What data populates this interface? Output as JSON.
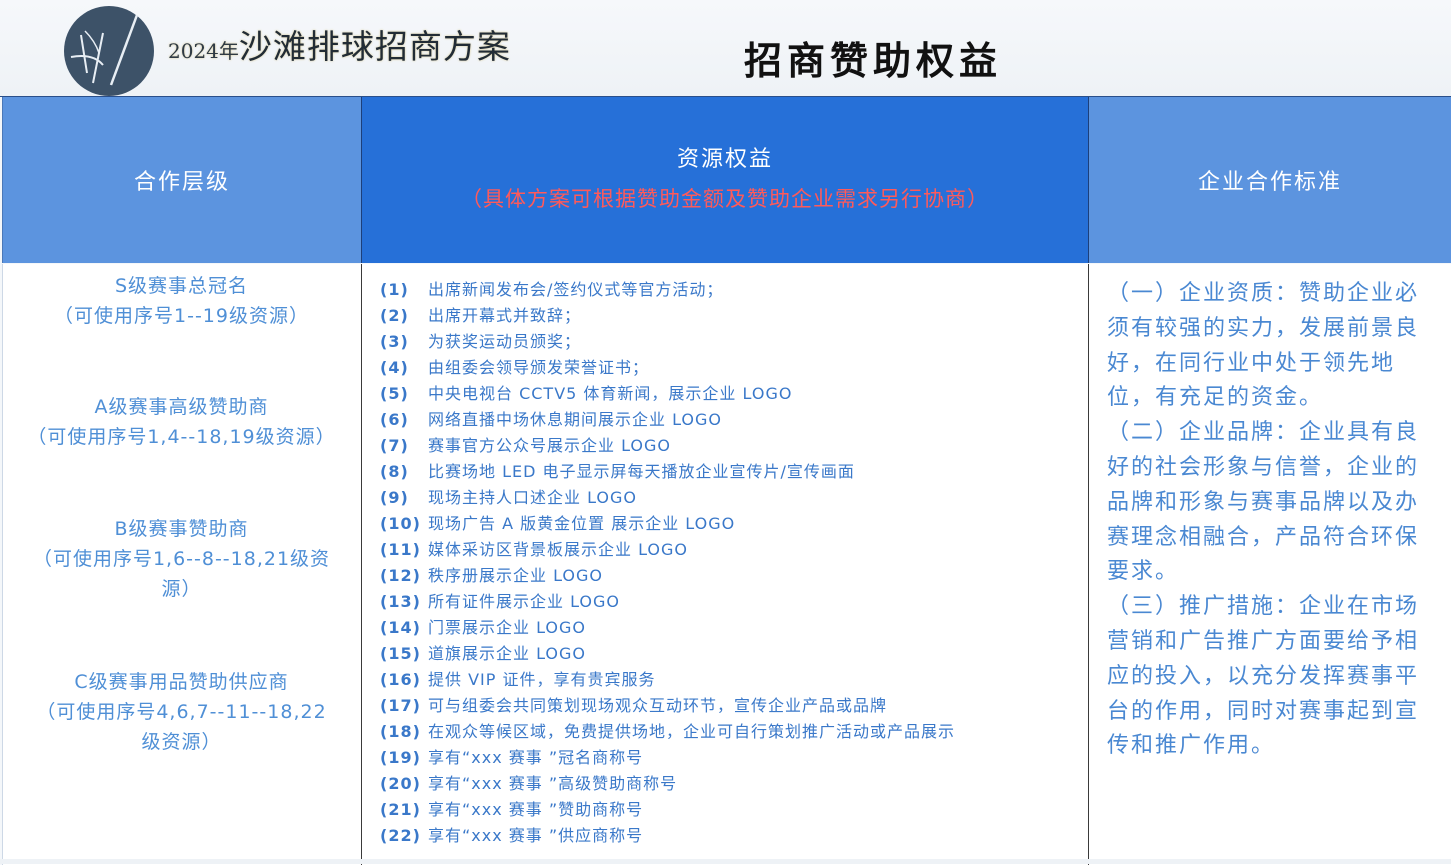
{
  "header": {
    "year": "2024年",
    "project_name": "沙滩排球招商方案",
    "page_title": "招商赞助权益"
  },
  "table": {
    "col_level_header": "合作层级",
    "col_resources_header": "资源权益",
    "col_resources_note": "（具体方案可根据赞助金额及赞助企业需求另行协商）",
    "col_standard_header": "企业合作标准"
  },
  "tiers": [
    {
      "name": "S级赛事总冠名",
      "scope": "（可使用序号1--19级资源）"
    },
    {
      "name": "A级赛事高级赞助商",
      "scope": "（可使用序号1,4--18,19级资源）"
    },
    {
      "name": "B级赛事赞助商",
      "scope": "（可使用序号1,6--8--18,21级资",
      "scope_2": "源）"
    },
    {
      "name": "C级赛事用品赞助供应商",
      "scope": "（可使用序号4,6,7--11--18,22",
      "scope_2": "级资源）"
    }
  ],
  "resources": [
    {
      "num": "(1)",
      "text": "出席新闻发布会/签约仪式等官方活动；"
    },
    {
      "num": "(2)",
      "text": "出席开幕式并致辞；"
    },
    {
      "num": "(3)",
      "text": "为获奖运动员颁奖；"
    },
    {
      "num": "(4)",
      "text": "由组委会领导颁发荣誉证书；"
    },
    {
      "num": "(5)",
      "text": "中央电视台 CCTV5 体育新闻，展示企业 LOGO"
    },
    {
      "num": "(6)",
      "text": "网络直播中场休息期间展示企业 LOGO"
    },
    {
      "num": "(7)",
      "text": "赛事官方公众号展示企业 LOGO"
    },
    {
      "num": "(8)",
      "text": "比赛场地 LED 电子显示屏每天播放企业宣传片/宣传画面"
    },
    {
      "num": "(9)",
      "text": "现场主持人口述企业 LOGO"
    },
    {
      "num": "(10)",
      "text": "现场广告 A 版黄金位置 展示企业 LOGO"
    },
    {
      "num": "(11)",
      "text": "媒体采访区背景板展示企业 LOGO"
    },
    {
      "num": "(12)",
      "text": "秩序册展示企业 LOGO"
    },
    {
      "num": "(13)",
      "text": "所有证件展示企业 LOGO"
    },
    {
      "num": "(14)",
      "text": "门票展示企业 LOGO"
    },
    {
      "num": "(15)",
      "text": "道旗展示企业 LOGO"
    },
    {
      "num": "(16)",
      "text": "提供 VIP 证件，享有贵宾服务"
    },
    {
      "num": "(17)",
      "text": "可与组委会共同策划现场观众互动环节，宣传企业产品或品牌"
    },
    {
      "num": "(18)",
      "text": "在观众等候区域，免费提供场地，企业可自行策划推广活动或产品展示"
    },
    {
      "num": "(19)",
      "text": "享有“xxx 赛事 ”冠名商称号"
    },
    {
      "num": "(20)",
      "text": "享有“xxx 赛事 ”高级赞助商称号"
    },
    {
      "num": "(21)",
      "text": "享有“xxx 赛事 ”赞助商称号"
    },
    {
      "num": "(22)",
      "text": "享有“xxx 赛事 ”供应商称号"
    }
  ],
  "standards": [
    "（一）企业资质：赞助企业必须有较强的实力，发展前景良好，在同行业中处于领先地位，有充足的资金。",
    "（二）企业品牌：企业具有良好的社会形象与信誉，企业的品牌和形象与赛事品牌以及办赛理念相融合，产品符合环保要求。",
    "（三）推广措施：企业在市场营销和广告推广方面要给予相应的投入，以充分发挥赛事平台的作用，同时对赛事起到宣传和推广作用。"
  ]
}
